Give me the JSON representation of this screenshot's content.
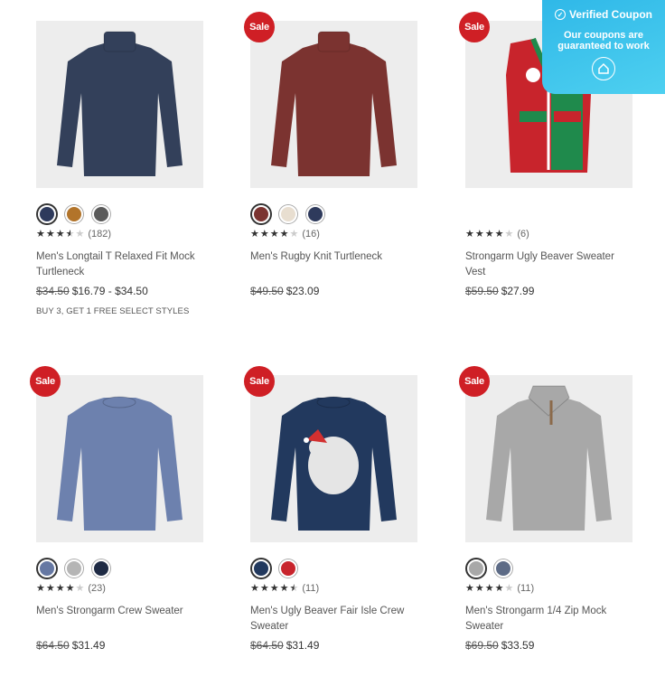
{
  "products": [
    {
      "name": "Men's Longtail T Relaxed Fit Mock Turtleneck",
      "sale": false,
      "garment_color": "#33405a",
      "swatches": [
        "#2e3a5c",
        "#b2742a",
        "#5a5a5a"
      ],
      "rating": 3.5,
      "reviews": "(182)",
      "was_price": "$34.50",
      "price": "$16.79 - $34.50",
      "promo": "BUY 3, GET 1 FREE SELECT STYLES"
    },
    {
      "name": "Men's Rugby Knit Turtleneck",
      "sale": true,
      "garment_color": "#7b3330",
      "swatches": [
        "#7b3330",
        "#e8ded0",
        "#2e3a5c"
      ],
      "rating": 4,
      "reviews": "(16)",
      "was_price": "$49.50",
      "price": "$23.09",
      "promo": ""
    },
    {
      "name": "Strongarm Ugly Beaver Sweater Vest",
      "sale": true,
      "garment_color": "#c8242c",
      "swatches": [],
      "rating": 4,
      "reviews": "(6)",
      "was_price": "$59.50",
      "price": "$27.99",
      "promo": ""
    },
    {
      "name": "Men's Strongarm Crew Sweater",
      "sale": true,
      "garment_color": "#6d81ae",
      "swatches": [
        "#6678a3",
        "#b5b5b5",
        "#1e2a44"
      ],
      "rating": 4,
      "reviews": "(23)",
      "was_price": "$64.50",
      "price": "$31.49",
      "promo": ""
    },
    {
      "name": "Men's Ugly Beaver Fair Isle Crew Sweater",
      "sale": true,
      "garment_color": "#22395e",
      "swatches": [
        "#22395e",
        "#c8242c"
      ],
      "rating": 4.5,
      "reviews": "(11)",
      "was_price": "$64.50",
      "price": "$31.49",
      "promo": ""
    },
    {
      "name": "Men's Strongarm 1/4 Zip Mock Sweater",
      "sale": true,
      "garment_color": "#a8a8a8",
      "swatches": [
        "#a8a8a8",
        "#5d6b86"
      ],
      "rating": 4,
      "reviews": "(11)",
      "was_price": "$69.50",
      "price": "$33.59",
      "promo": ""
    }
  ],
  "sale_label": "Sale",
  "coupon": {
    "title": "Verified Coupon",
    "line1": "Our coupons are",
    "line2": "guaranteed to work"
  }
}
